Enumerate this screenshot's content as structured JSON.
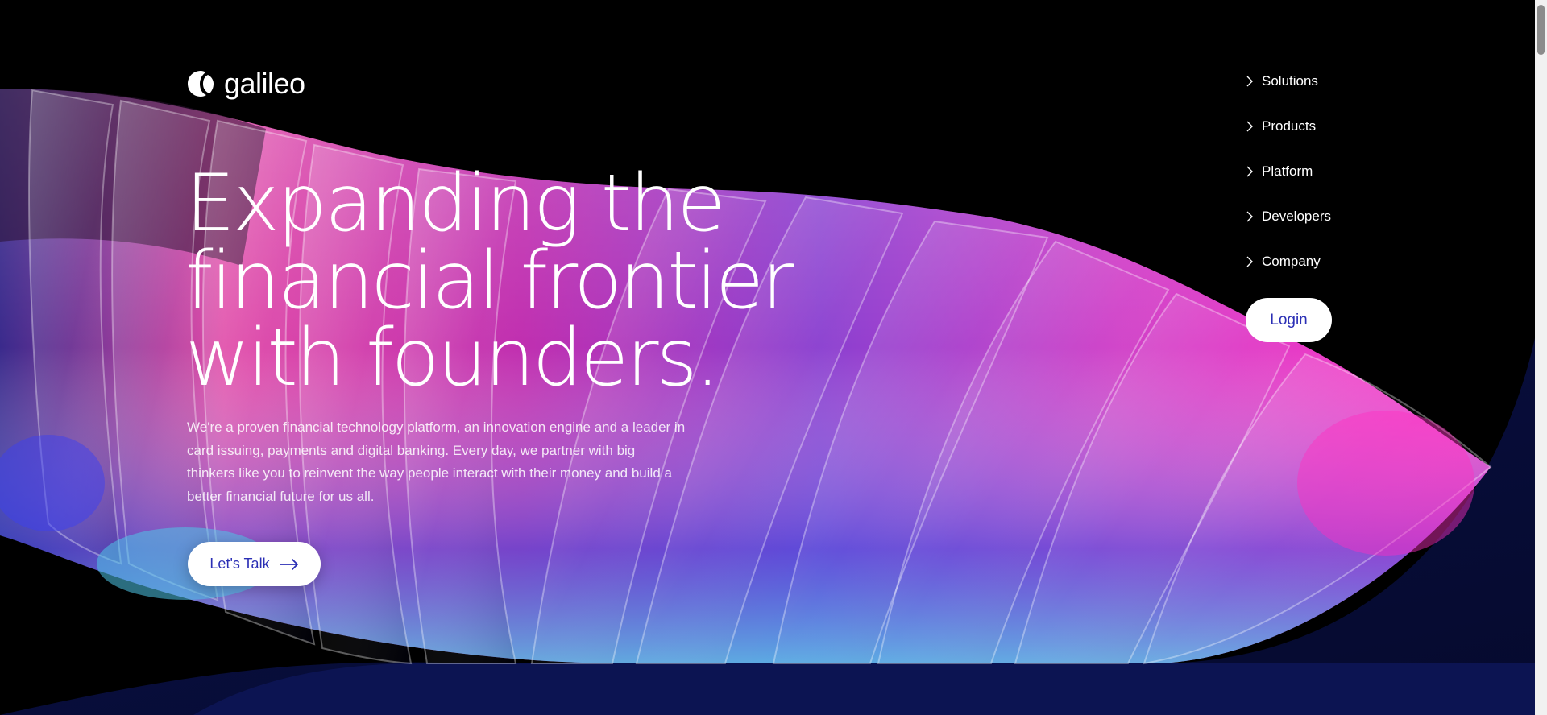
{
  "brand": {
    "name": "galileo",
    "logo_icon": "galileo-crescent-logo"
  },
  "nav": {
    "items": [
      {
        "label": "Solutions",
        "icon": "chevron-right-icon"
      },
      {
        "label": "Products",
        "icon": "chevron-right-icon"
      },
      {
        "label": "Platform",
        "icon": "chevron-right-icon"
      },
      {
        "label": "Developers",
        "icon": "chevron-right-icon"
      },
      {
        "label": "Company",
        "icon": "chevron-right-icon"
      }
    ],
    "login_label": "Login"
  },
  "hero": {
    "title_lines": [
      "Expanding the",
      "financial frontier",
      "with founders."
    ],
    "description": "We're a proven financial technology platform, an innovation engine and a leader in card issuing, payments and digital banking. Every day, we partner with big thinkers like you to reinvent the way people interact with their money and build a better financial future for us all.",
    "cta_label": "Let's Talk",
    "cta_icon": "arrow-right-icon"
  },
  "colors": {
    "background": "#000000",
    "accent": "#2b2fb5",
    "magenta": "#ff2fc0",
    "navy": "#0a1046",
    "cyan": "#4fc6e8"
  }
}
